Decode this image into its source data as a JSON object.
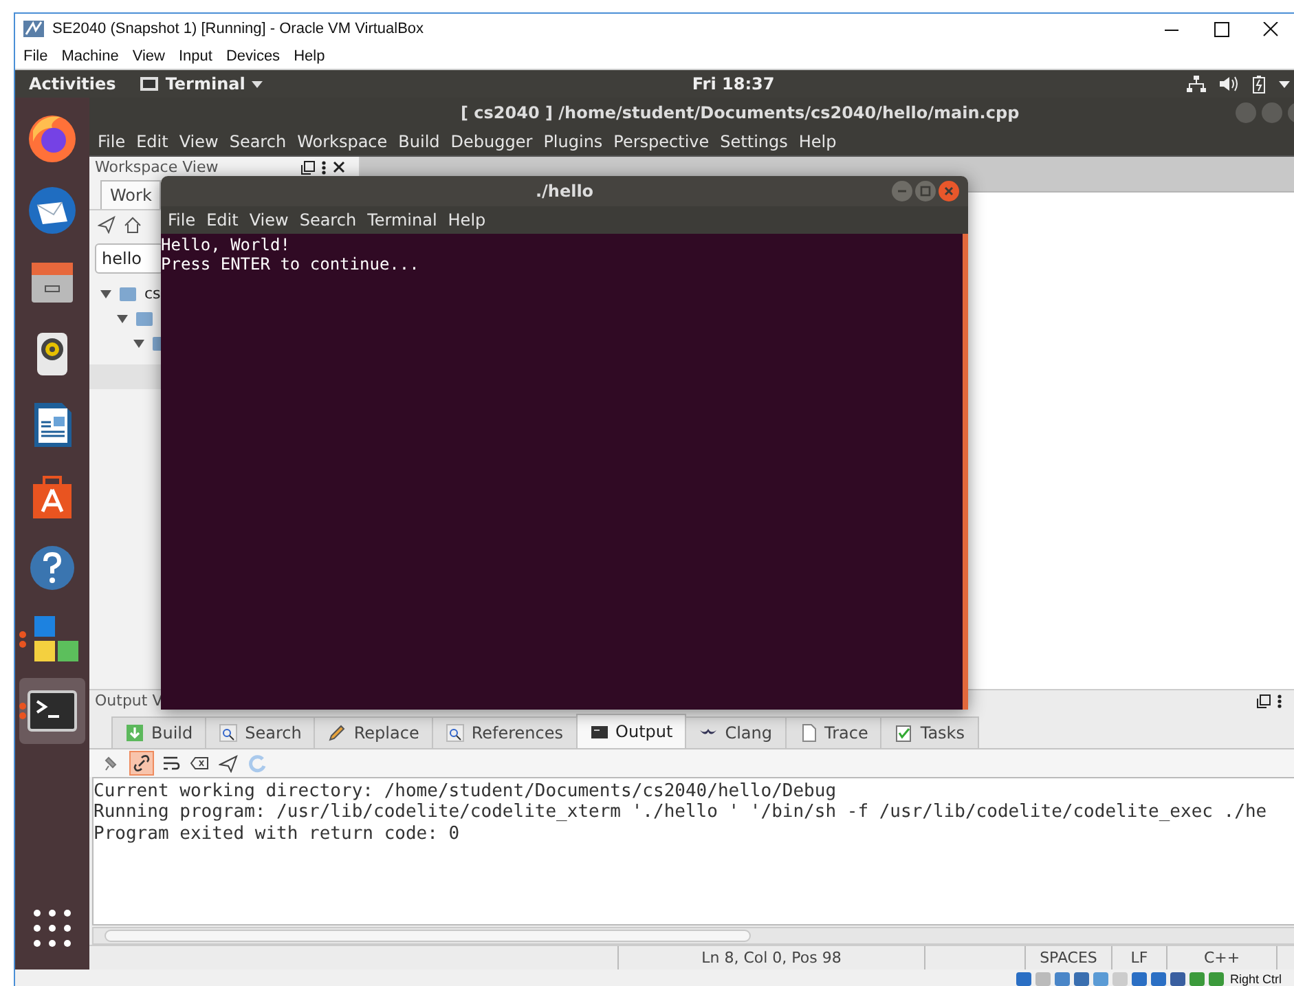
{
  "vbox": {
    "title": "SE2040 (Snapshot 1) [Running] - Oracle VM VirtualBox",
    "menu": [
      "File",
      "Machine",
      "View",
      "Input",
      "Devices",
      "Help"
    ],
    "host_key": "Right Ctrl"
  },
  "topbar": {
    "activities": "Activities",
    "app_menu": "Terminal",
    "clock": "Fri 18:37"
  },
  "dock": [
    {
      "kind": "browser",
      "running": false,
      "selected": false
    },
    {
      "kind": "mail",
      "running": false,
      "selected": false
    },
    {
      "kind": "files",
      "running": false,
      "selected": false
    },
    {
      "kind": "music",
      "running": false,
      "selected": false
    },
    {
      "kind": "document",
      "running": false,
      "selected": false
    },
    {
      "kind": "store",
      "running": false,
      "selected": false
    },
    {
      "kind": "help",
      "running": false,
      "selected": false
    },
    {
      "kind": "apps",
      "running": true,
      "selected": false
    },
    {
      "kind": "terminal",
      "running": true,
      "selected": true
    }
  ],
  "ide": {
    "title": "[ cs2040 ] /home/student/Documents/cs2040/hello/main.cpp",
    "menu": [
      "File",
      "Edit",
      "View",
      "Search",
      "Workspace",
      "Build",
      "Debugger",
      "Plugins",
      "Perspective",
      "Settings",
      "Help"
    ],
    "workspace": {
      "title": "Workspace View",
      "tab": "Work",
      "filter": "hello",
      "tree": [
        {
          "label": "cs",
          "expanded": true,
          "children": [
            {
              "expanded": true,
              "children": [
                {
                  "expanded": true
                }
              ]
            }
          ]
        }
      ]
    },
    "output": {
      "title": "Output V",
      "tabs": [
        {
          "label": "Build",
          "selected": false
        },
        {
          "label": "Search",
          "selected": false
        },
        {
          "label": "Replace",
          "selected": false
        },
        {
          "label": "References",
          "selected": false
        },
        {
          "label": "Output",
          "selected": true
        },
        {
          "label": "Clang",
          "selected": false
        },
        {
          "label": "Trace",
          "selected": false
        },
        {
          "label": "Tasks",
          "selected": false
        }
      ],
      "toolbar": [
        {
          "kind": "pin",
          "on": false
        },
        {
          "kind": "link",
          "on": true
        },
        {
          "kind": "wrap",
          "on": false
        },
        {
          "kind": "clear",
          "on": false
        },
        {
          "kind": "send",
          "on": false
        },
        {
          "kind": "refresh",
          "on": false
        }
      ],
      "lines": [
        "Current working directory: /home/student/Documents/cs2040/hello/Debug",
        "Running program: /usr/lib/codelite/codelite_xterm './hello ' '/bin/sh -f /usr/lib/codelite/codelite_exec ./he",
        "Program exited with return code: 0"
      ]
    },
    "status": [
      "Ln 8, Col 0, Pos 98",
      "SPACES",
      "LF",
      "C++"
    ]
  },
  "terminal": {
    "title": "./hello",
    "menu": [
      "File",
      "Edit",
      "View",
      "Search",
      "Terminal",
      "Help"
    ],
    "lines": [
      "Hello, World!",
      "Press ENTER to continue..."
    ]
  }
}
